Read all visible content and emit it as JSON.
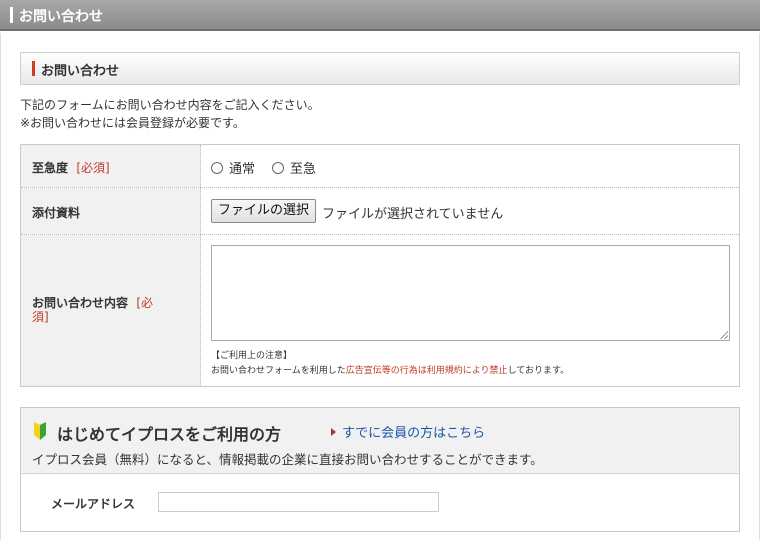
{
  "header": {
    "title": "お問い合わせ"
  },
  "section": {
    "title": "お問い合わせ"
  },
  "intro": {
    "line1": "下記のフォームにお問い合わせ内容をご記入ください。",
    "line2": "※お問い合わせには会員登録が必要です。"
  },
  "form": {
    "urgency": {
      "label": "至急度",
      "required": "[必須]",
      "options": [
        "通常",
        "至急"
      ]
    },
    "attachment": {
      "label": "添付資料",
      "button": "ファイルの選択",
      "status": "ファイルが選択されていません"
    },
    "content": {
      "label": "お問い合わせ内容",
      "required_part1": "[必",
      "required_part2": "須]",
      "textarea_value": "",
      "notice_title": "【ご利用上の注意】",
      "notice_pre": "お問い合わせフォームを利用した",
      "notice_highlight": "広告宣伝等の行為は利用規約により禁止",
      "notice_post": "しております。"
    }
  },
  "member": {
    "heading": "はじめてイプロスをご利用の方",
    "existing_link": "すでに会員の方はこちら",
    "description": "イプロス会員（無料）になると、情報掲載の企業に直接お問い合わせすることができます。",
    "email_label": "メールアドレス",
    "email_value": ""
  },
  "colors": {
    "accent_red": "#c0392b",
    "link_blue": "#1a56a8",
    "header_gray": "#8c8c8c",
    "leaf_green": "#36a62c",
    "leaf_yellow": "#f2d21b"
  }
}
